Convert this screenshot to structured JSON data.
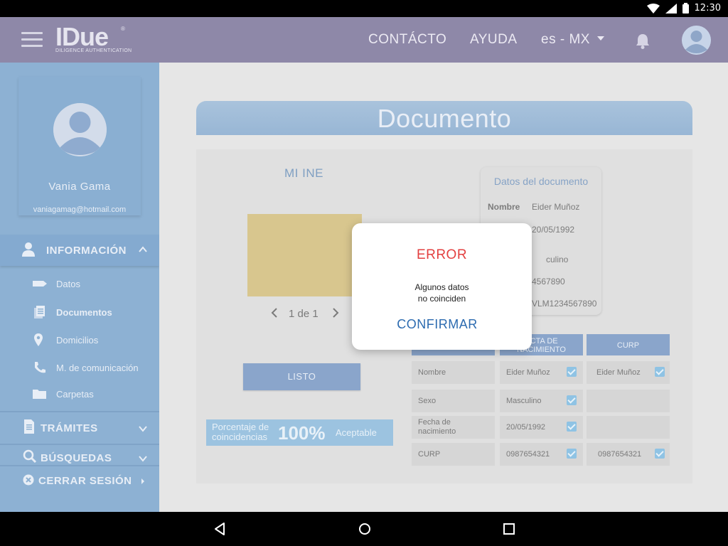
{
  "status_bar": {
    "time": "12:30"
  },
  "header": {
    "logo_main": "IDue",
    "logo_reg": "®",
    "logo_sub": "DILIGENCE AUTHENTICATION",
    "nav": {
      "contact": "CONTÁCTO",
      "help": "AYUDA",
      "lang": "es - MX"
    },
    "icons": [
      "menu-icon",
      "bell-icon",
      "user-avatar-icon"
    ]
  },
  "sidebar": {
    "profile": {
      "name": "Vania Gama",
      "email": "vaniagamag@hotmail.com"
    },
    "info_section": {
      "label": "INFORMACIÓN"
    },
    "items": [
      {
        "label": "Datos",
        "icon": "tag-icon"
      },
      {
        "label": "Documentos",
        "icon": "documents-icon"
      },
      {
        "label": "Domicilios",
        "icon": "location-pin-icon"
      },
      {
        "label": "M. de comunicación",
        "icon": "phone-icon"
      },
      {
        "label": "Carpetas",
        "icon": "folder-icon"
      }
    ],
    "tramites": {
      "label": "TRÁMITES"
    },
    "busquedas": {
      "label": "BÚSQUEDAS"
    },
    "cerrar": {
      "label": "CERRAR SESIÓN"
    }
  },
  "main": {
    "title": "Documento",
    "ine_label": "MI INE",
    "pager": {
      "text": "1 de 1"
    },
    "listo_label": "LISTO",
    "percentage": {
      "label": "Porcentaje de coincidencias",
      "value": "100%",
      "status": "Aceptable"
    },
    "datos_card": {
      "title": "Datos del documento",
      "rows": [
        {
          "label": "Nombre",
          "value": "Eider Muñoz"
        },
        {
          "label": "",
          "value": "20/05/1992"
        },
        {
          "label": "",
          "value": "culino"
        },
        {
          "label": "",
          "value": "4567890"
        },
        {
          "label": "",
          "value": "VLM1234567890"
        }
      ]
    },
    "comparison": {
      "headers": {
        "acta": "ACTA DE NACIMIENTO",
        "curp": "CURP"
      },
      "rows": [
        {
          "field": "Nombre",
          "acta": "Eider Muñoz",
          "curp": "Eider Muñoz"
        },
        {
          "field": "Sexo",
          "acta": "Masculino",
          "curp": ""
        },
        {
          "field": "Fecha de nacimiento",
          "acta": "20/05/1992",
          "curp": ""
        },
        {
          "field": "CURP",
          "acta": "0987654321",
          "curp": "0987654321"
        }
      ]
    }
  },
  "dialog": {
    "title": "ERROR",
    "message_line1": "Algunos datos",
    "message_line2": "no coinciden",
    "confirm_label": "CONFIRMAR"
  },
  "colors": {
    "appbar": "#8e88a8",
    "sidebar": "#8db1d3",
    "error": "#e34040",
    "confirm": "#2c6bb0",
    "accent_blue": "#8aa5cb"
  }
}
